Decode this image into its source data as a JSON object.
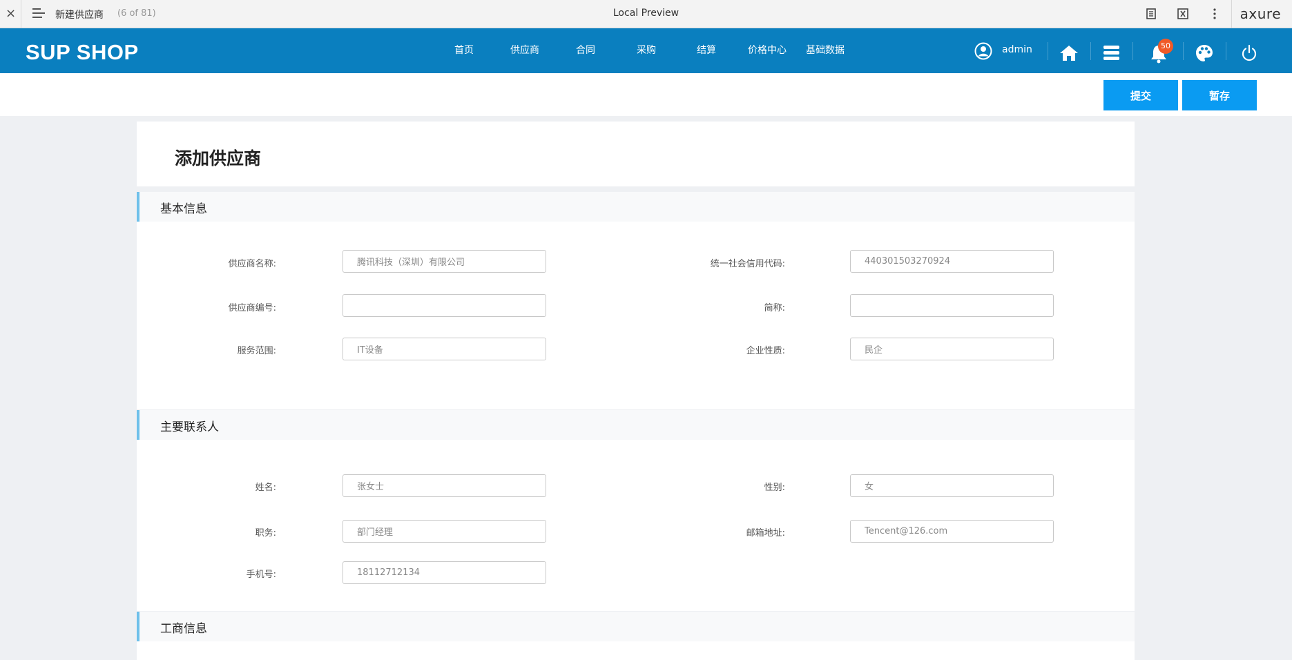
{
  "chrome": {
    "close_label": "×",
    "page_name": "新建供应商",
    "page_count": "(6 of 81)",
    "center_title": "Local Preview",
    "brand": "axure"
  },
  "header": {
    "logo": "SUP SHOP",
    "nav": [
      "首页",
      "供应商",
      "合同",
      "采购",
      "结算",
      "价格中心",
      "基础数据"
    ],
    "user_name": "admin",
    "notification_count": "50",
    "accent_color": "#0a7fbf",
    "badge_color": "#f05a28"
  },
  "actions": {
    "submit_label": "提交",
    "save_label": "暂存",
    "button_color": "#0a9bf2"
  },
  "page": {
    "title": "添加供应商"
  },
  "sections": {
    "basic": {
      "title": "基本信息",
      "name_label": "供应商名称:",
      "name_value": "腾讯科技（深圳）有限公司",
      "credit_label": "统一社会信用代码:",
      "credit_value": "440301503270924",
      "code_label": "供应商编号:",
      "code_value": "",
      "short_label": "简称:",
      "short_value": "",
      "scope_label": "服务范围:",
      "scope_value": "IT设备",
      "nature_label": "企业性质:",
      "nature_value": "民企"
    },
    "contact": {
      "title": "主要联系人",
      "name_label": "姓名:",
      "name_value": "张女士",
      "gender_label": "性别:",
      "gender_value": "女",
      "position_label": "职务:",
      "position_value": "部门经理",
      "email_label": "邮箱地址:",
      "email_value": "Tencent@126.com",
      "phone_label": "手机号:",
      "phone_value": "18112712134"
    },
    "business": {
      "title": "工商信息"
    }
  }
}
